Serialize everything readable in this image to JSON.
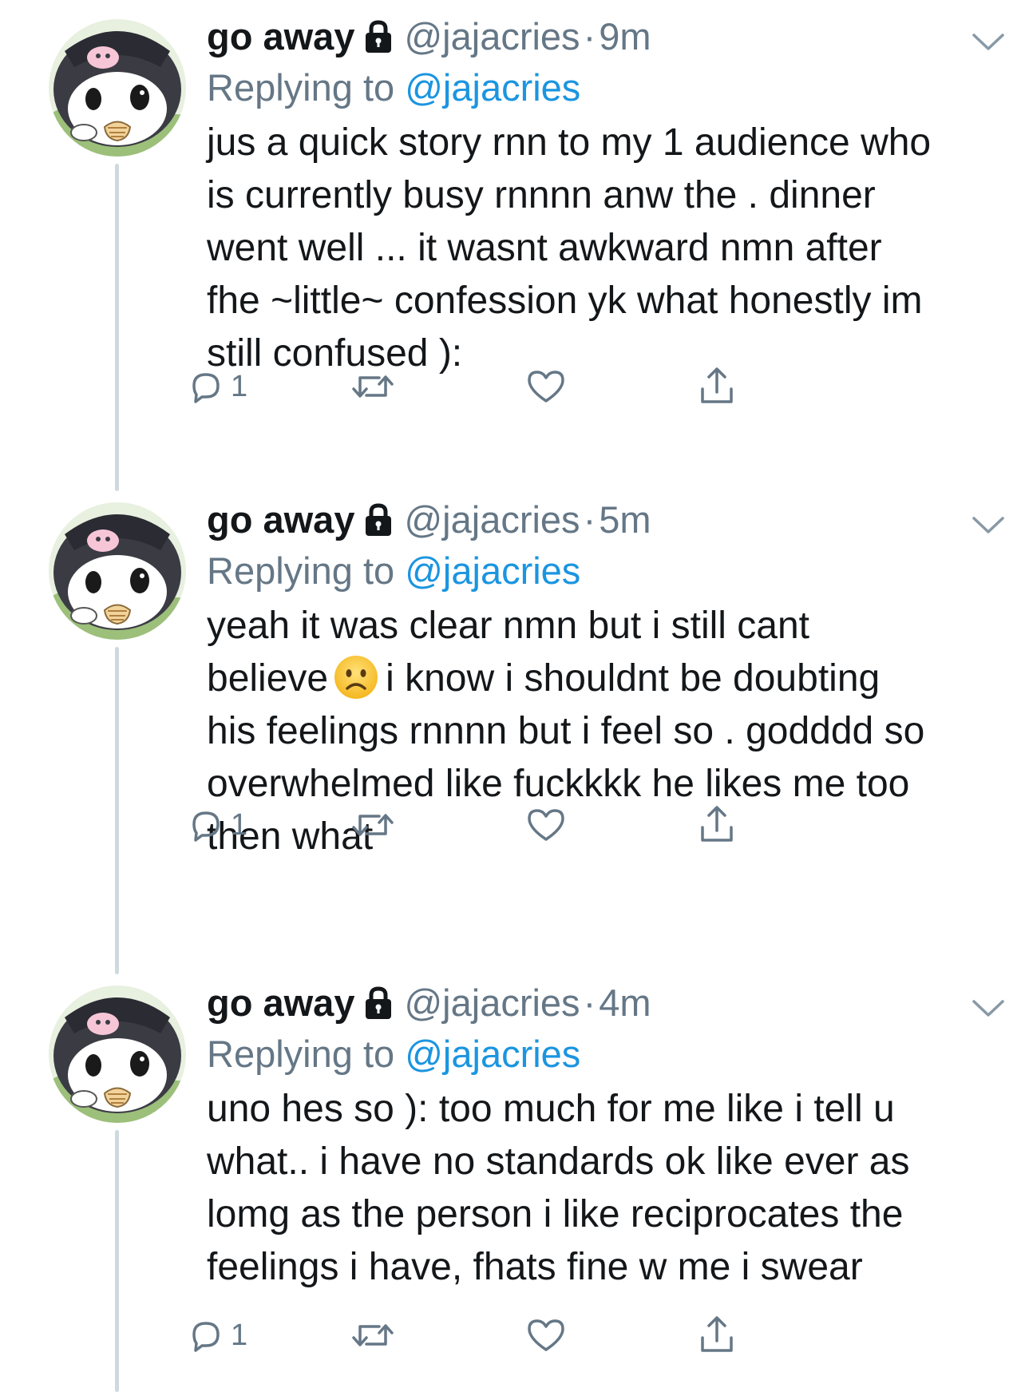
{
  "tweets": [
    {
      "name": "go away",
      "handle": "@jajacries",
      "separator": "·",
      "time": "9m",
      "replying_prefix": "Replying to ",
      "replying_to": "@jajacries",
      "text": "jus a quick story rnn to my 1 audience who\nis currently busy rnnnn anw the . dinner\nwent well ... it wasnt awkward nmn after\nfhe ~little~ confession yk what honestly im\nstill confused ):",
      "reply_count": "1"
    },
    {
      "name": "go away",
      "handle": "@jajacries",
      "separator": "·",
      "time": "5m",
      "replying_prefix": "Replying to ",
      "replying_to": "@jajacries",
      "text_before_emoji": "yeah it was clear nmn but i still cant\nbelieve",
      "emoji": "slightly-frowning-face",
      "text_after_emoji": "i know i shouldnt be doubting\nhis feelings rnnnn but i feel so . godddd so\noverwhelmed like fuckkkk he likes me too\nthen what",
      "reply_count": "1"
    },
    {
      "name": "go away",
      "handle": "@jajacries",
      "separator": "·",
      "time": "4m",
      "replying_prefix": "Replying to ",
      "replying_to": "@jajacries",
      "text": "uno hes so ): too much for me like i tell u\nwhat.. i have no standards ok like ever as\nlomg as the person i like reciprocates the\nfeelings i have, fhats fine w me i swear",
      "reply_count": "1"
    }
  ],
  "icons": [
    "lock-icon",
    "chevron-down-icon",
    "reply-icon",
    "retweet-icon",
    "like-icon",
    "share-icon"
  ],
  "colors": {
    "text": "#14171a",
    "secondary": "#657786",
    "link": "#1b95e0",
    "thread_line": "#cfd9de"
  }
}
